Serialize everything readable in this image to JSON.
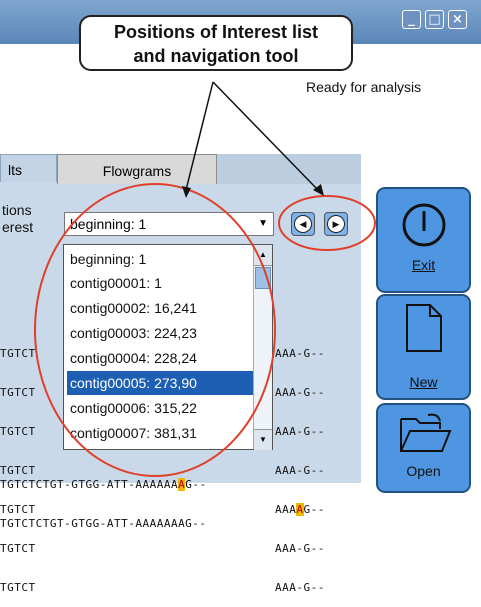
{
  "window": {
    "minimize_glyph": "_",
    "maximize_glyph": "□",
    "close_glyph": "×"
  },
  "status_text": "Ready for analysis",
  "tabs": [
    {
      "label": "lts"
    },
    {
      "label": "Flowgrams"
    }
  ],
  "poi": {
    "label_line1": "tions",
    "label_line2": "erest",
    "selected": "beginning: 1",
    "items": [
      "beginning: 1",
      "contig00001: 1",
      "contig00002: 16,241",
      "contig00003: 224,23",
      "contig00004: 228,24",
      "contig00005: 273,90",
      "contig00006: 315,22",
      "contig00007: 381,31"
    ],
    "highlighted_index": 5
  },
  "sequence": {
    "left_lines": [
      "TGTCT",
      "TGTCT",
      "TGTCT",
      "TGTCT",
      "TGTCT",
      "TGTCT",
      "TGTCT"
    ],
    "right_lines": [
      "AAA-G--",
      "AAA-G--",
      "AAA-G--",
      "AAA-G--",
      "AAAAG--",
      "AAA-G--",
      "AAA-G--"
    ],
    "highlight_line": 4,
    "bottom_prefix": "TGTCTCTGT-GTGG-ATT-AAAAAA",
    "bottom_highlight": "A",
    "bottom_suffix": "G--",
    "last_line": "TGTCTCTGT-GTGG-ATT-AAAAAAAG--"
  },
  "buttons": {
    "exit": "Exit",
    "new": "New",
    "open": "Open"
  },
  "callout": {
    "line1": "Positions of Interest list",
    "line2": "and navigation tool"
  },
  "colors": {
    "title_bar": "#6a93c3",
    "panel": "#cad9e9",
    "button": "#4e96e1",
    "selection": "#1d5fb3",
    "annotation": "#e0402a"
  }
}
